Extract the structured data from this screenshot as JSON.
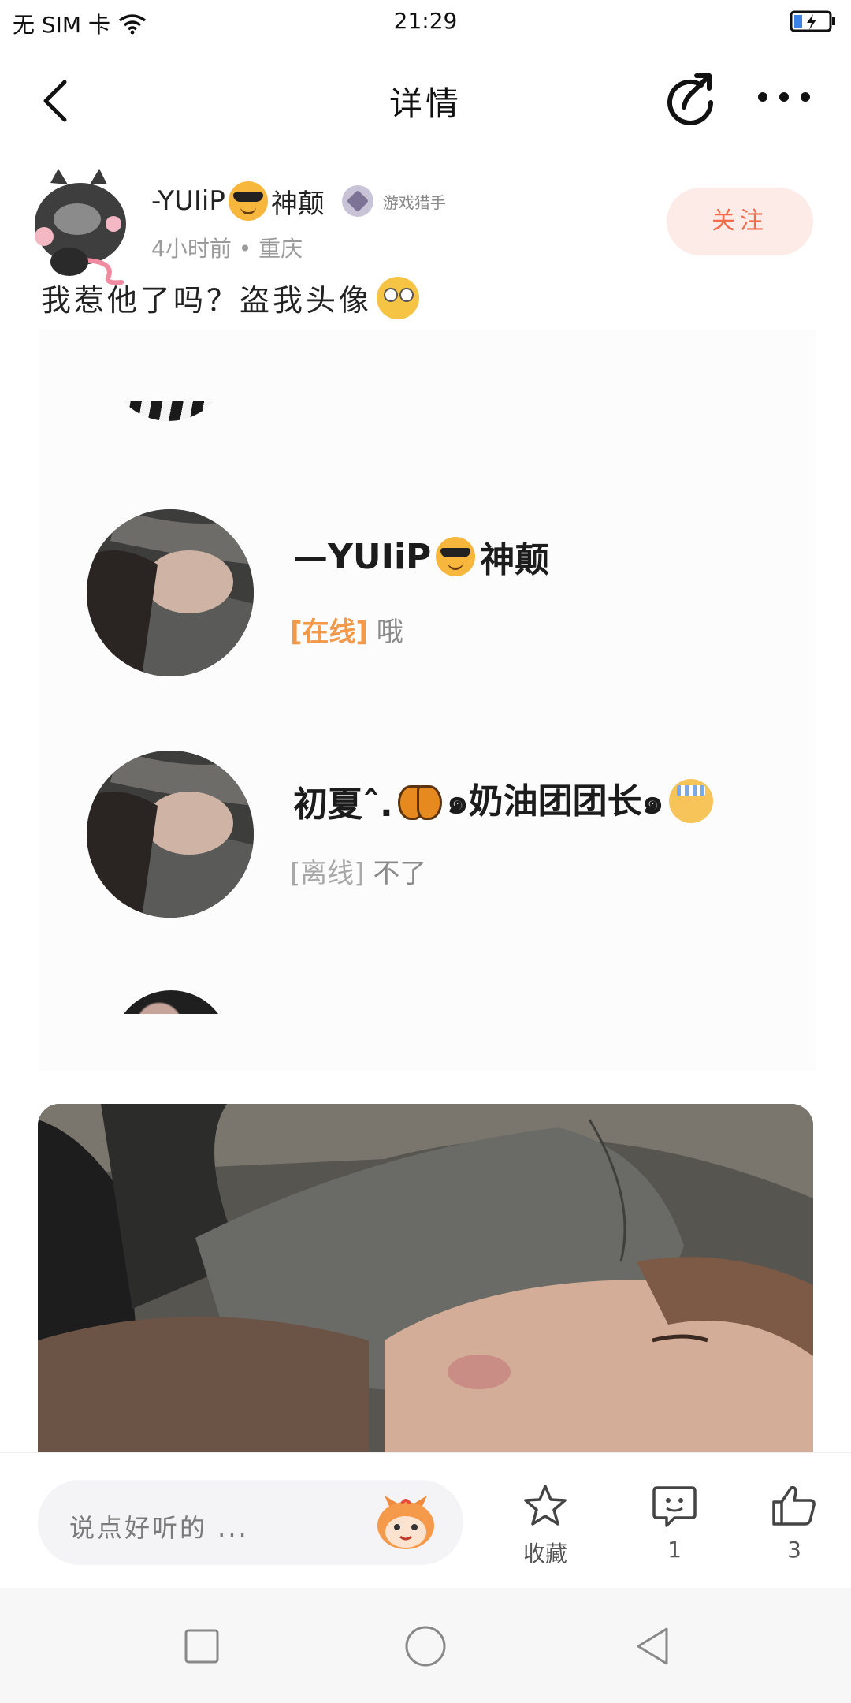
{
  "status_bar": {
    "carrier": "无 SIM 卡",
    "time": "21:29"
  },
  "header": {
    "title": "详情"
  },
  "post": {
    "author": {
      "name": "-YUIiP",
      "name_suffix": "神颠",
      "badge": "游戏猎手",
      "meta": "4小时前 • 重庆"
    },
    "follow_label": "关注",
    "text": "我惹他了吗？盗我头像"
  },
  "screenshot": {
    "chats": [
      {
        "name": "—YUIiP",
        "name_suffix": "神颠",
        "status": "[在线]",
        "message": "哦"
      },
      {
        "name": "初夏ˆ.",
        "name_suffix": "๑奶油团团长๑",
        "status": "[离线]",
        "message": "不了"
      }
    ]
  },
  "actions": {
    "comment_placeholder": "说点好听的 ...",
    "favorite_label": "收藏",
    "comment_count": "1",
    "like_count": "3"
  },
  "colors": {
    "accent": "#f36b4a",
    "follow_bg": "#fdebe7",
    "online": "#f2994a"
  }
}
